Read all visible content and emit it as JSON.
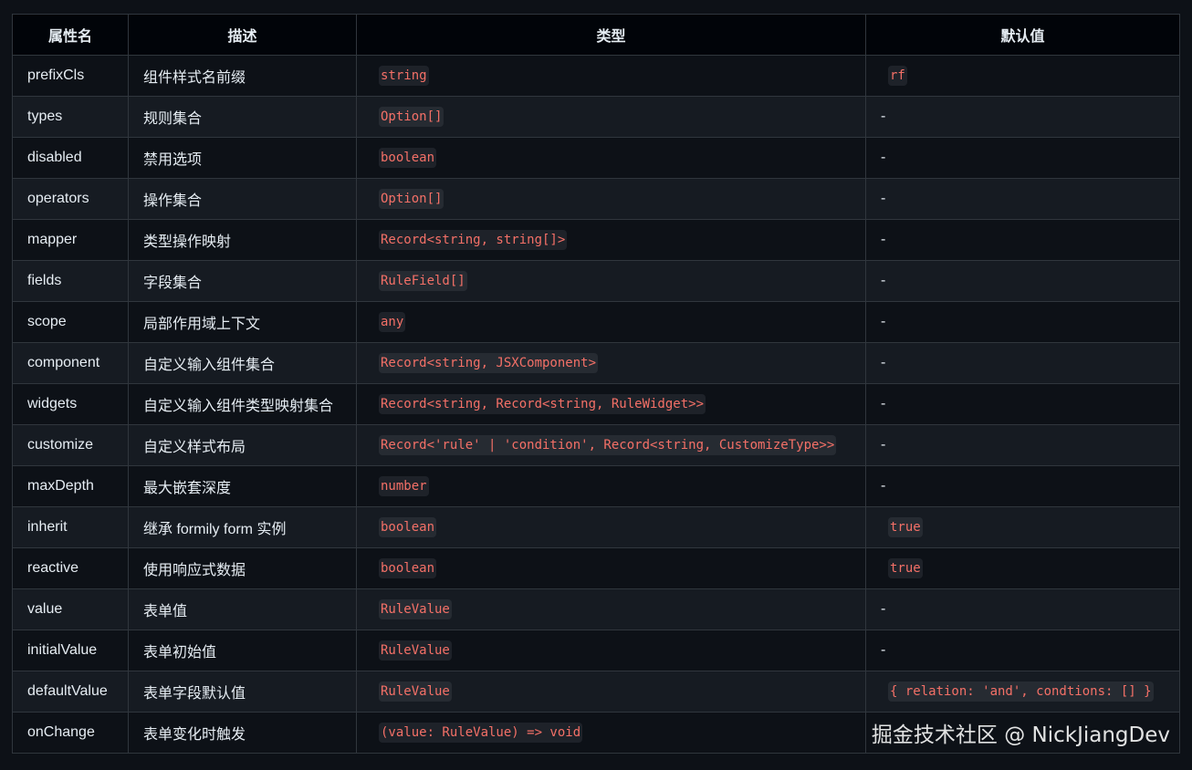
{
  "table": {
    "headers": [
      "属性名",
      "描述",
      "类型",
      "默认值"
    ],
    "rows": [
      {
        "name": "prefixCls",
        "desc": "组件样式名前缀",
        "type": "string",
        "default": "rf",
        "default_is_code": true
      },
      {
        "name": "types",
        "desc": "规则集合",
        "type": "Option[]",
        "default": "-",
        "default_is_code": false
      },
      {
        "name": "disabled",
        "desc": "禁用选项",
        "type": "boolean",
        "default": "-",
        "default_is_code": false
      },
      {
        "name": "operators",
        "desc": "操作集合",
        "type": "Option[]",
        "default": "-",
        "default_is_code": false
      },
      {
        "name": "mapper",
        "desc": "类型操作映射",
        "type": "Record<string, string[]>",
        "default": "-",
        "default_is_code": false
      },
      {
        "name": "fields",
        "desc": "字段集合",
        "type": "RuleField[]",
        "default": "-",
        "default_is_code": false
      },
      {
        "name": "scope",
        "desc": "局部作用域上下文",
        "type": "any",
        "default": "-",
        "default_is_code": false
      },
      {
        "name": "component",
        "desc": "自定义输入组件集合",
        "type": "Record<string, JSXComponent>",
        "default": "-",
        "default_is_code": false
      },
      {
        "name": "widgets",
        "desc": "自定义输入组件类型映射集合",
        "type": "Record<string, Record<string, RuleWidget>>",
        "default": "-",
        "default_is_code": false
      },
      {
        "name": "customize",
        "desc": "自定义样式布局",
        "type": "Record<'rule' | 'condition', Record<string, CustomizeType>>",
        "default": "-",
        "default_is_code": false
      },
      {
        "name": "maxDepth",
        "desc": "最大嵌套深度",
        "type": "number",
        "default": "-",
        "default_is_code": false
      },
      {
        "name": "inherit",
        "desc": "继承 formily form 实例",
        "type": "boolean",
        "default": "true",
        "default_is_code": true
      },
      {
        "name": "reactive",
        "desc": "使用响应式数据",
        "type": "boolean",
        "default": "true",
        "default_is_code": true
      },
      {
        "name": "value",
        "desc": "表单值",
        "type": "RuleValue",
        "default": "-",
        "default_is_code": false
      },
      {
        "name": "initialValue",
        "desc": "表单初始值",
        "type": "RuleValue",
        "default": "-",
        "default_is_code": false
      },
      {
        "name": "defaultValue",
        "desc": "表单字段默认值",
        "type": "RuleValue",
        "default": "{ relation: 'and', condtions: [] }",
        "default_is_code": true
      },
      {
        "name": "onChange",
        "desc": "表单变化时触发",
        "type": "(value: RuleValue) => void",
        "default": "",
        "default_is_code": false
      }
    ]
  },
  "watermark": "掘金技术社区 @ NickJiangDev",
  "colors": {
    "background": "#0d1117",
    "row_alt": "#161b22",
    "border": "#30363d",
    "code_text": "#f47067"
  }
}
